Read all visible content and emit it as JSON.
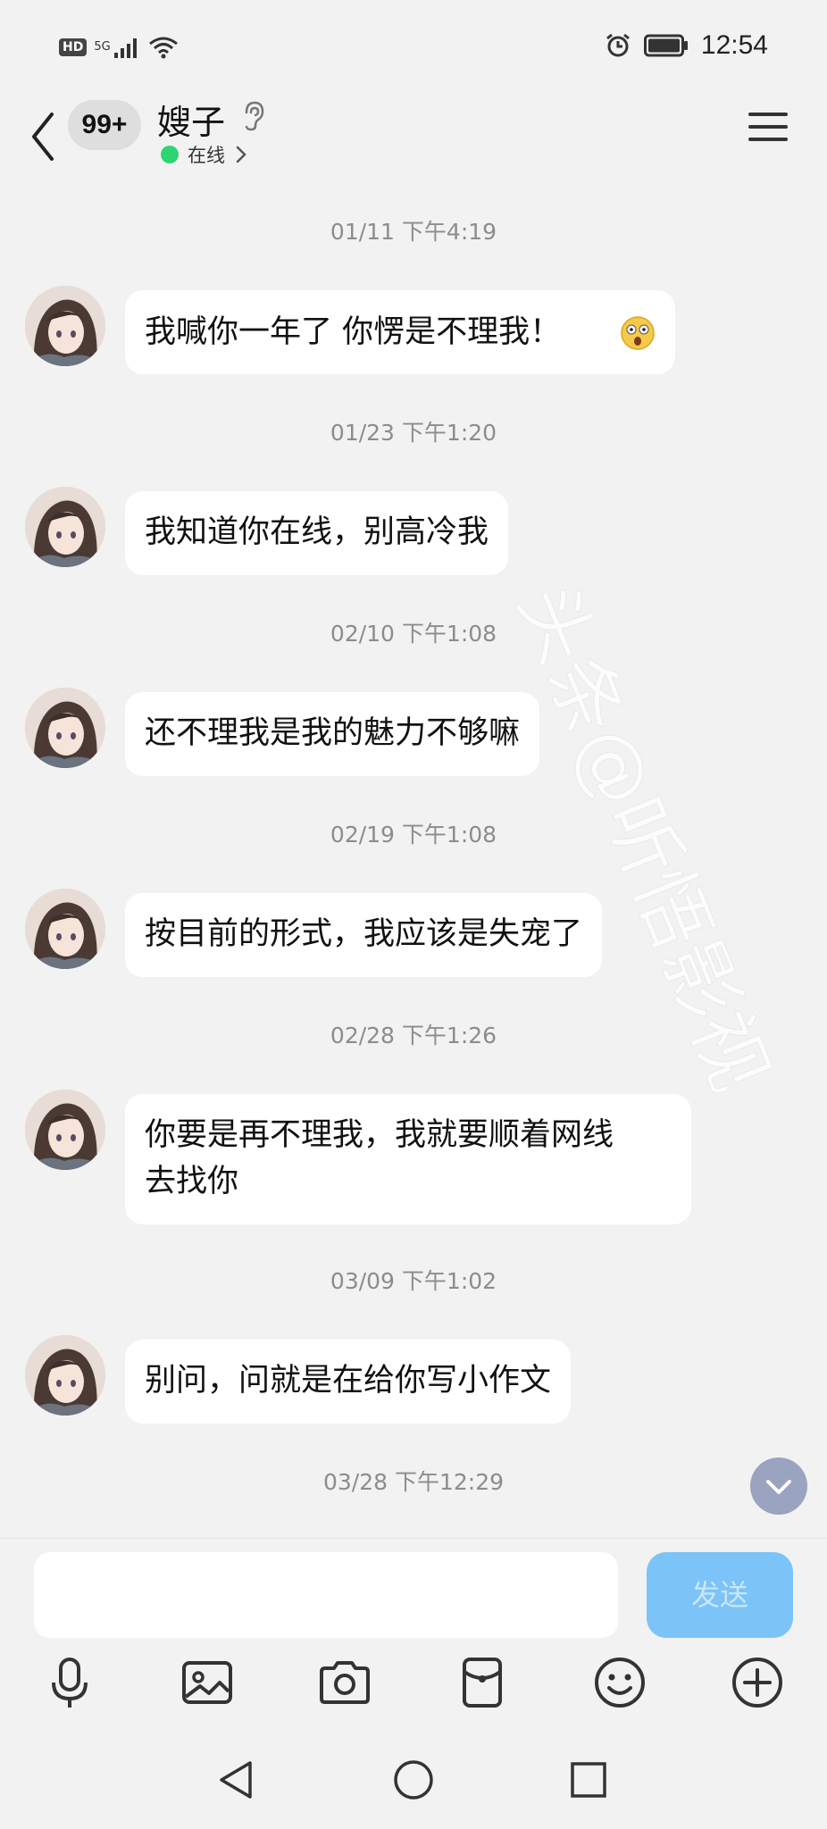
{
  "status_bar": {
    "hd": "HD",
    "network": "5G",
    "time": "12:54"
  },
  "header": {
    "unread_count": "99+",
    "contact_name": "嫂子",
    "online_status": "在线",
    "icons": [
      "back-icon",
      "ear-icon",
      "chevron-right-icon",
      "menu-icon"
    ]
  },
  "messages": [
    {
      "timestamp": "01/11 下午4:19",
      "text": "我喊你一年了 你愣是不理我！",
      "emoji": "astonished-face"
    },
    {
      "timestamp": "01/23 下午1:20",
      "text": "我知道你在线，别高冷我"
    },
    {
      "timestamp": "02/10 下午1:08",
      "text": "还不理我是我的魅力不够嘛"
    },
    {
      "timestamp": "02/19 下午1:08",
      "text": "按目前的形式，我应该是失宠了"
    },
    {
      "timestamp": "02/28 下午1:26",
      "text_line1": "你要是再不理我，我就要顺着网线",
      "text_line2": "去找你"
    },
    {
      "timestamp": "03/09 下午1:02",
      "text": "别问，问就是在给你写小作文"
    },
    {
      "timestamp": "03/28 下午12:29"
    }
  ],
  "composer": {
    "input_value": "",
    "send_label": "发送",
    "send_color": "#7cc4f7"
  },
  "toolbar_icons": [
    "microphone-icon",
    "image-icon",
    "camera-icon",
    "red-packet-icon",
    "emoji-icon",
    "plus-icon"
  ],
  "nav_icons": [
    "nav-back-icon",
    "nav-home-icon",
    "nav-recents-icon"
  ],
  "watermark": "头条@听悟影视",
  "colors": {
    "background": "#f2f2f2",
    "bubble": "#ffffff",
    "online": "#2ed573",
    "scroll_down_button": "#9aa3bf"
  }
}
